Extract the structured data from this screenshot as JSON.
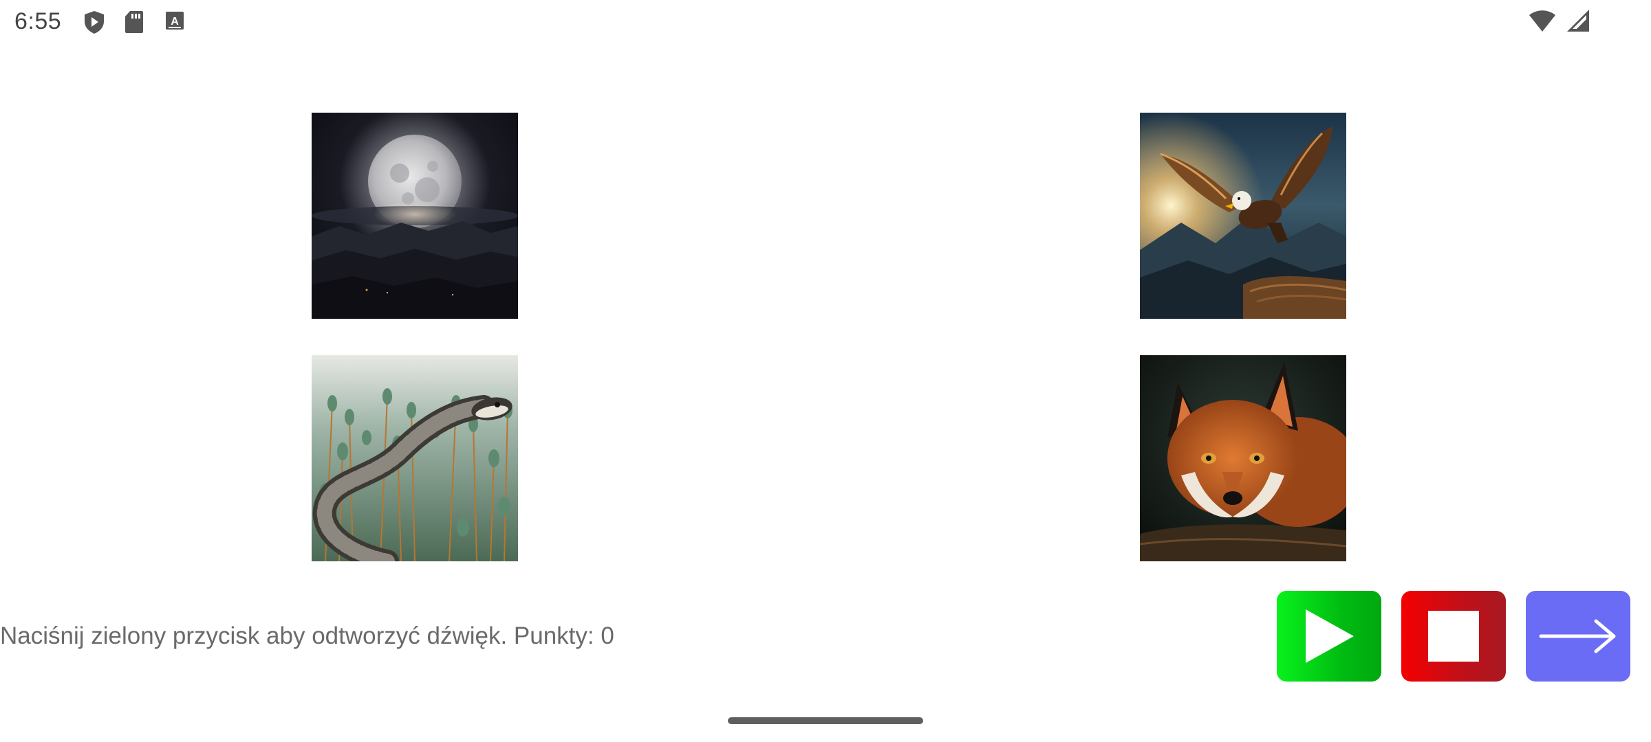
{
  "status_bar": {
    "time": "6:55",
    "left_icons": [
      "play-protect-icon",
      "sd-card-icon",
      "keyboard-a-icon"
    ],
    "right_icons": [
      "wifi-icon",
      "cell-signal-icon"
    ]
  },
  "images": [
    {
      "name": "moon",
      "alt": "moon"
    },
    {
      "name": "eagle",
      "alt": "eagle"
    },
    {
      "name": "snake",
      "alt": "snake"
    },
    {
      "name": "fox",
      "alt": "fox"
    }
  ],
  "instruction": "Naciśnij zielony przycisk aby odtworzyć dźwięk. Punkty: 0",
  "controls": {
    "play": {
      "icon": "play-icon",
      "color": "#00d916"
    },
    "stop": {
      "icon": "stop-icon",
      "color": "#e00010"
    },
    "next": {
      "icon": "arrow-right-icon",
      "color": "#6b6cf5"
    }
  }
}
